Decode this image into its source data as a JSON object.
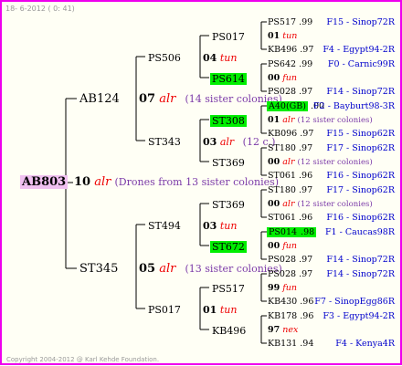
{
  "header": {
    "date": "18-  6-2012 (  0: 41)"
  },
  "root": {
    "id": "AB803",
    "gen": "10",
    "tag": "alr",
    "note": "(Drones from 13 sister colonies)"
  },
  "l1": {
    "a": {
      "id": "AB124",
      "gen": "07",
      "tag": "alr",
      "note": "(14 sister colonies)"
    },
    "b": {
      "id": "ST345",
      "gen": "05",
      "tag": "alr",
      "note": "(13 sister colonies)"
    }
  },
  "l2": {
    "ps506": {
      "id": "PS506",
      "gen": "04",
      "tag": "tun"
    },
    "st343": {
      "id": "ST343",
      "gen": "03",
      "tag": "alr",
      "note": "(12 c.)"
    },
    "st494": {
      "id": "ST494",
      "gen": "03",
      "tag": "tun"
    },
    "ps017": {
      "id": "PS017",
      "gen": "01",
      "tag": "tun"
    }
  },
  "l3": {
    "ps017": "PS017",
    "ps614": "PS614",
    "st308": "ST308",
    "st369a": "ST369",
    "st369b": "ST369",
    "st672": "ST672",
    "ps517": "PS517",
    "kb496": "KB496"
  },
  "l4": [
    {
      "id": "PS517",
      "yr": ".99",
      "origin": "F15 - Sinop72R"
    },
    {
      "gen": "01",
      "tag": "tun"
    },
    {
      "id": "KB496",
      "yr": ".97",
      "origin": "F4 - Egypt94-2R"
    },
    {
      "id": "PS642",
      "yr": ".99",
      "origin": "F0 - Carnic99R"
    },
    {
      "gen": "00",
      "tag": "fun"
    },
    {
      "id": "PS028",
      "yr": ".97",
      "origin": "F14 - Sinop72R"
    },
    {
      "id": "A40(GB)",
      "yr": ".00",
      "origin": "F2 - Bayburt98-3R"
    },
    {
      "gen": "01",
      "tag": "alr",
      "note": "(12 sister colonies)"
    },
    {
      "id": "KB096",
      "yr": ".97",
      "origin": "F15 - Sinop62R"
    },
    {
      "id": "ST180",
      "yr": ".97",
      "origin": "F17 - Sinop62R"
    },
    {
      "gen": "00",
      "tag": "alr",
      "note": "(12 sister colonies)"
    },
    {
      "id": "ST061",
      "yr": ".96",
      "origin": "F16 - Sinop62R"
    },
    {
      "id": "ST180",
      "yr": ".97",
      "origin": "F17 - Sinop62R"
    },
    {
      "gen": "00",
      "tag": "alr",
      "note": "(12 sister colonies)"
    },
    {
      "id": "ST061",
      "yr": ".96",
      "origin": "F16 - Sinop62R"
    },
    {
      "id": "PS014",
      "yr": ".98",
      "origin": "F1 - Caucas98R"
    },
    {
      "gen": "00",
      "tag": "fun"
    },
    {
      "id": "PS028",
      "yr": ".97",
      "origin": "F14 - Sinop72R"
    },
    {
      "id": "PS028",
      "yr": ".97",
      "origin": "F14 - Sinop72R"
    },
    {
      "gen": "99",
      "tag": "fun"
    },
    {
      "id": "KB430",
      "yr": ".96",
      "origin": "F7 - SinopEgg86R"
    },
    {
      "id": "KB178",
      "yr": ".96",
      "origin": "F3 - Egypt94-2R"
    },
    {
      "gen": "97",
      "tag": "nex"
    },
    {
      "id": "KB131",
      "yr": ".94",
      "origin": "F4 - Kenya4R"
    }
  ],
  "footer": {
    "copyright": "Copyright 2004-2012 @ Karl Kehde Foundation."
  },
  "colors": {
    "border": "#ee00ee",
    "tag": "#ee0000",
    "note": "#7b3aa8",
    "origin": "#0000cc",
    "highlight": "#00ee00",
    "root_box": "#f0c0f0"
  }
}
